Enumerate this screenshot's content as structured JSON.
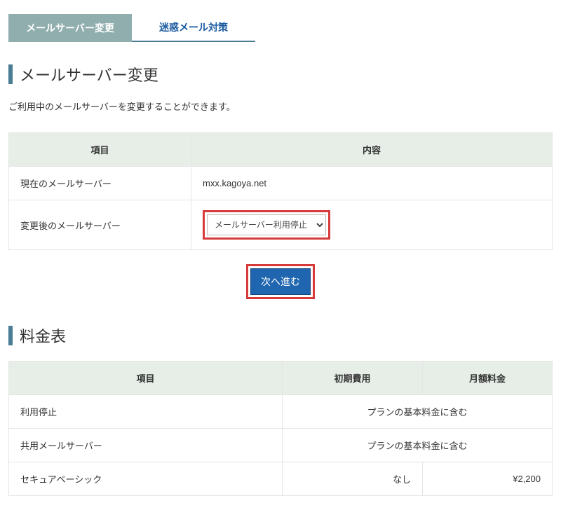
{
  "tabs": {
    "active": {
      "label": "メールサーバー変更"
    },
    "inactive": {
      "label": "迷惑メール対策"
    }
  },
  "section1": {
    "heading": "メールサーバー変更",
    "desc": "ご利用中のメールサーバーを変更することができます。",
    "table": {
      "head": {
        "item": "項目",
        "content": "内容"
      },
      "row_current": {
        "label": "現在のメールサーバー",
        "value": "mxx.kagoya.net"
      },
      "row_after": {
        "label": "変更後のメールサーバー",
        "select_value": "メールサーバー利用停止"
      }
    },
    "button": "次へ進む"
  },
  "section2": {
    "heading": "料金表",
    "table": {
      "head": {
        "item": "項目",
        "init": "初期費用",
        "monthly": "月額料金"
      },
      "rows": [
        {
          "name": "利用停止",
          "merged": "プランの基本料金に含む"
        },
        {
          "name": "共用メールサーバー",
          "merged": "プランの基本料金に含む"
        },
        {
          "name": "セキュアベーシック",
          "init": "なし",
          "monthly": "¥2,200"
        }
      ]
    }
  }
}
